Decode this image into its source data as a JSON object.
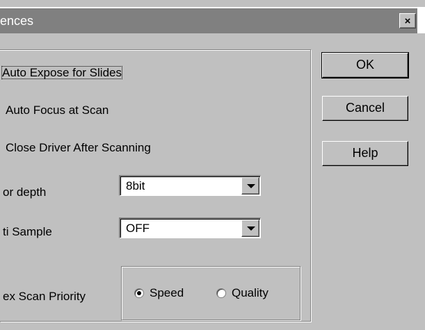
{
  "window": {
    "title": "ences",
    "close_symbol": "×"
  },
  "checkboxes": [
    {
      "label": "Auto Expose for Slides"
    },
    {
      "label": "Auto Focus at Scan"
    },
    {
      "label": "Close Driver After Scanning"
    }
  ],
  "color_depth": {
    "label": "or depth",
    "value": "8bit"
  },
  "multi_sample": {
    "label": "ti Sample",
    "value": "OFF"
  },
  "index_scan": {
    "label": "ex Scan Priority",
    "options": [
      {
        "label": "Speed",
        "checked": true
      },
      {
        "label": "Quality",
        "checked": false
      }
    ]
  },
  "buttons": {
    "ok": "OK",
    "cancel": "Cancel",
    "help": "Help"
  },
  "icons": {
    "close": "close-icon",
    "dropdown": "chevron-down-icon",
    "radio": "radio-button-icon"
  },
  "colors": {
    "face": "#c0c0c0",
    "title_bar": "#808080",
    "title_text": "#ffffff"
  }
}
